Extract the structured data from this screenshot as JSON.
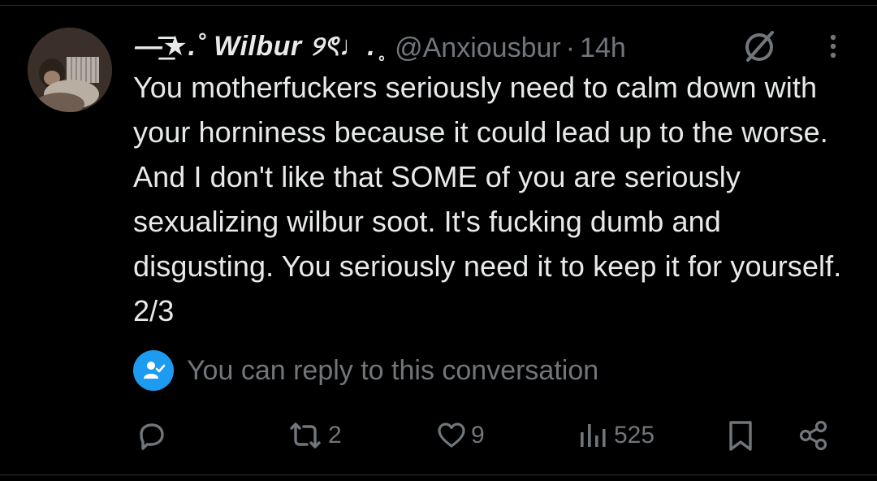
{
  "tweet": {
    "display_name": "—͟͞͞★.˚ Wilbur ୨ৎ♩. ̥",
    "handle": "@Anxiousbur",
    "separator": "·",
    "time": "14h",
    "text": "You motherfuckers seriously need to calm down with your horniness because it could lead up to the worse. And I don't like that SOME of you are seriously sexualizing wilbur soot. It's fucking dumb and disgusting. You seriously need it to keep it for yourself. 2/3"
  },
  "reply_notice": {
    "text": "You can reply to this conversation",
    "icon": "person-check-icon"
  },
  "actions": {
    "reply_icon": "reply-bubble-icon",
    "retweet_count": "2",
    "like_count": "9",
    "views_count": "525"
  },
  "colors": {
    "background": "#000000",
    "text": "#e7e9ea",
    "muted": "#71767b",
    "accent": "#1d9bf0"
  }
}
